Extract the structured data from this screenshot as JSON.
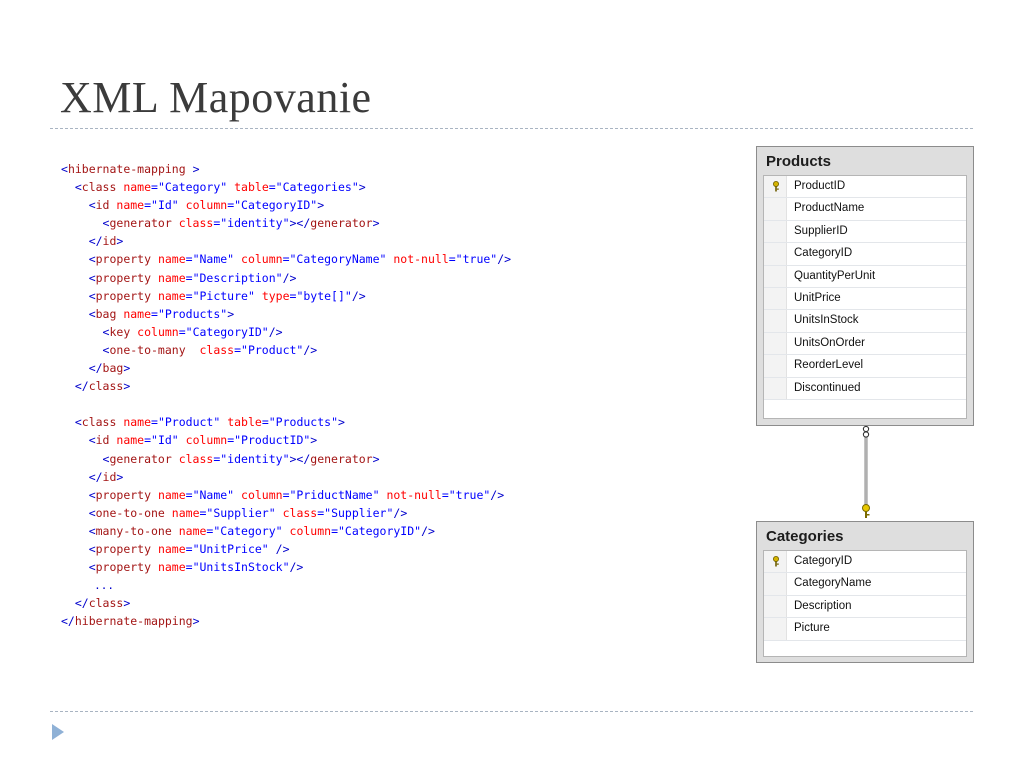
{
  "slide": {
    "title": "XML Mapovanie"
  },
  "code_lines": [
    [
      {
        "t": "<",
        "c": "pu"
      },
      {
        "t": "hibernate-mapping",
        "c": "tg"
      },
      {
        "t": " >",
        "c": "pu"
      }
    ],
    [
      {
        "t": "  <",
        "c": "pu"
      },
      {
        "t": "class",
        "c": "tg"
      },
      {
        "t": " name",
        "c": "at"
      },
      {
        "t": "=\"Category\"",
        "c": "vl"
      },
      {
        "t": " table",
        "c": "at"
      },
      {
        "t": "=\"Categories\"",
        "c": "vl"
      },
      {
        "t": ">",
        "c": "pu"
      }
    ],
    [
      {
        "t": "    <",
        "c": "pu"
      },
      {
        "t": "id",
        "c": "tg"
      },
      {
        "t": " name",
        "c": "at"
      },
      {
        "t": "=\"Id\"",
        "c": "vl"
      },
      {
        "t": " column",
        "c": "at"
      },
      {
        "t": "=\"CategoryID\"",
        "c": "vl"
      },
      {
        "t": ">",
        "c": "pu"
      }
    ],
    [
      {
        "t": "      <",
        "c": "pu"
      },
      {
        "t": "generator",
        "c": "tg"
      },
      {
        "t": " class",
        "c": "at"
      },
      {
        "t": "=\"identity\"",
        "c": "vl"
      },
      {
        "t": "></",
        "c": "pu"
      },
      {
        "t": "generator",
        "c": "tg"
      },
      {
        "t": ">",
        "c": "pu"
      }
    ],
    [
      {
        "t": "    </",
        "c": "pu"
      },
      {
        "t": "id",
        "c": "tg"
      },
      {
        "t": ">",
        "c": "pu"
      }
    ],
    [
      {
        "t": "    <",
        "c": "pu"
      },
      {
        "t": "property",
        "c": "tg"
      },
      {
        "t": " name",
        "c": "at"
      },
      {
        "t": "=\"Name\"",
        "c": "vl"
      },
      {
        "t": " column",
        "c": "at"
      },
      {
        "t": "=\"CategoryName\"",
        "c": "vl"
      },
      {
        "t": " not-null",
        "c": "at"
      },
      {
        "t": "=\"true\"",
        "c": "vl"
      },
      {
        "t": "/>",
        "c": "pu"
      }
    ],
    [
      {
        "t": "    <",
        "c": "pu"
      },
      {
        "t": "property",
        "c": "tg"
      },
      {
        "t": " name",
        "c": "at"
      },
      {
        "t": "=\"Description\"",
        "c": "vl"
      },
      {
        "t": "/>",
        "c": "pu"
      }
    ],
    [
      {
        "t": "    <",
        "c": "pu"
      },
      {
        "t": "property",
        "c": "tg"
      },
      {
        "t": " name",
        "c": "at"
      },
      {
        "t": "=\"Picture\"",
        "c": "vl"
      },
      {
        "t": " type",
        "c": "at"
      },
      {
        "t": "=\"byte[]\"",
        "c": "vl"
      },
      {
        "t": "/>",
        "c": "pu"
      }
    ],
    [
      {
        "t": "    <",
        "c": "pu"
      },
      {
        "t": "bag",
        "c": "tg"
      },
      {
        "t": " name",
        "c": "at"
      },
      {
        "t": "=\"Products\"",
        "c": "vl"
      },
      {
        "t": ">",
        "c": "pu"
      }
    ],
    [
      {
        "t": "      <",
        "c": "pu"
      },
      {
        "t": "key",
        "c": "tg"
      },
      {
        "t": " column",
        "c": "at"
      },
      {
        "t": "=\"CategoryID\"",
        "c": "vl"
      },
      {
        "t": "/>",
        "c": "pu"
      }
    ],
    [
      {
        "t": "      <",
        "c": "pu"
      },
      {
        "t": "one-to-many",
        "c": "tg"
      },
      {
        "t": "  class",
        "c": "at"
      },
      {
        "t": "=\"Product\"",
        "c": "vl"
      },
      {
        "t": "/>",
        "c": "pu"
      }
    ],
    [
      {
        "t": "    </",
        "c": "pu"
      },
      {
        "t": "bag",
        "c": "tg"
      },
      {
        "t": ">",
        "c": "pu"
      }
    ],
    [
      {
        "t": "  </",
        "c": "pu"
      },
      {
        "t": "class",
        "c": "tg"
      },
      {
        "t": ">",
        "c": "pu"
      }
    ],
    [],
    [
      {
        "t": "  <",
        "c": "pu"
      },
      {
        "t": "class",
        "c": "tg"
      },
      {
        "t": " name",
        "c": "at"
      },
      {
        "t": "=\"Product\"",
        "c": "vl"
      },
      {
        "t": " table",
        "c": "at"
      },
      {
        "t": "=\"Products\"",
        "c": "vl"
      },
      {
        "t": ">",
        "c": "pu"
      }
    ],
    [
      {
        "t": "    <",
        "c": "pu"
      },
      {
        "t": "id",
        "c": "tg"
      },
      {
        "t": " name",
        "c": "at"
      },
      {
        "t": "=\"Id\"",
        "c": "vl"
      },
      {
        "t": " column",
        "c": "at"
      },
      {
        "t": "=\"ProductID\"",
        "c": "vl"
      },
      {
        "t": ">",
        "c": "pu"
      }
    ],
    [
      {
        "t": "      <",
        "c": "pu"
      },
      {
        "t": "generator",
        "c": "tg"
      },
      {
        "t": " class",
        "c": "at"
      },
      {
        "t": "=\"identity\"",
        "c": "vl"
      },
      {
        "t": "></",
        "c": "pu"
      },
      {
        "t": "generator",
        "c": "tg"
      },
      {
        "t": ">",
        "c": "pu"
      }
    ],
    [
      {
        "t": "    </",
        "c": "pu"
      },
      {
        "t": "id",
        "c": "tg"
      },
      {
        "t": ">",
        "c": "pu"
      }
    ],
    [
      {
        "t": "    <",
        "c": "pu"
      },
      {
        "t": "property",
        "c": "tg"
      },
      {
        "t": " name",
        "c": "at"
      },
      {
        "t": "=\"Name\"",
        "c": "vl"
      },
      {
        "t": " column",
        "c": "at"
      },
      {
        "t": "=\"PriductName\"",
        "c": "vl"
      },
      {
        "t": " not-null",
        "c": "at"
      },
      {
        "t": "=\"true\"",
        "c": "vl"
      },
      {
        "t": "/>",
        "c": "pu"
      }
    ],
    [
      {
        "t": "    <",
        "c": "pu"
      },
      {
        "t": "one-to-one",
        "c": "tg"
      },
      {
        "t": " name",
        "c": "at"
      },
      {
        "t": "=\"Supplier\"",
        "c": "vl"
      },
      {
        "t": " class",
        "c": "at"
      },
      {
        "t": "=\"Supplier\"",
        "c": "vl"
      },
      {
        "t": "/>",
        "c": "pu"
      }
    ],
    [
      {
        "t": "    <",
        "c": "pu"
      },
      {
        "t": "many-to-one",
        "c": "tg"
      },
      {
        "t": " name",
        "c": "at"
      },
      {
        "t": "=\"Category\"",
        "c": "vl"
      },
      {
        "t": " column",
        "c": "at"
      },
      {
        "t": "=\"CategoryID\"",
        "c": "vl"
      },
      {
        "t": "/>",
        "c": "pu"
      }
    ],
    [
      {
        "t": "    <",
        "c": "pu"
      },
      {
        "t": "property",
        "c": "tg"
      },
      {
        "t": " name",
        "c": "at"
      },
      {
        "t": "=\"UnitPrice\"",
        "c": "vl"
      },
      {
        "t": " />",
        "c": "pu"
      }
    ],
    [
      {
        "t": "    <",
        "c": "pu"
      },
      {
        "t": "property",
        "c": "tg"
      },
      {
        "t": " name",
        "c": "at"
      },
      {
        "t": "=\"UnitsInStock\"",
        "c": "vl"
      },
      {
        "t": "/>",
        "c": "pu"
      }
    ],
    [
      {
        "t": "     ...",
        "c": "ell"
      }
    ],
    [
      {
        "t": "  </",
        "c": "pu"
      },
      {
        "t": "class",
        "c": "tg"
      },
      {
        "t": ">",
        "c": "pu"
      }
    ],
    [
      {
        "t": "</",
        "c": "pu"
      },
      {
        "t": "hibernate-mapping",
        "c": "tg"
      },
      {
        "t": ">",
        "c": "pu"
      }
    ]
  ],
  "products_table": {
    "title": "Products",
    "columns": [
      {
        "name": "ProductID",
        "key": true
      },
      {
        "name": "ProductName",
        "key": false
      },
      {
        "name": "SupplierID",
        "key": false
      },
      {
        "name": "CategoryID",
        "key": false
      },
      {
        "name": "QuantityPerUnit",
        "key": false
      },
      {
        "name": "UnitPrice",
        "key": false
      },
      {
        "name": "UnitsInStock",
        "key": false
      },
      {
        "name": "UnitsOnOrder",
        "key": false
      },
      {
        "name": "ReorderLevel",
        "key": false
      },
      {
        "name": "Discontinued",
        "key": false
      }
    ]
  },
  "categories_table": {
    "title": "Categories",
    "columns": [
      {
        "name": "CategoryID",
        "key": true
      },
      {
        "name": "CategoryName",
        "key": false
      },
      {
        "name": "Description",
        "key": false
      },
      {
        "name": "Picture",
        "key": false
      }
    ]
  },
  "colors": {
    "tag": "#a31515",
    "attribute": "#ff0000",
    "value": "#0000ff",
    "punctuation": "#0000cc",
    "title": "#3b3b3b",
    "key_icon": "#d4b300"
  }
}
